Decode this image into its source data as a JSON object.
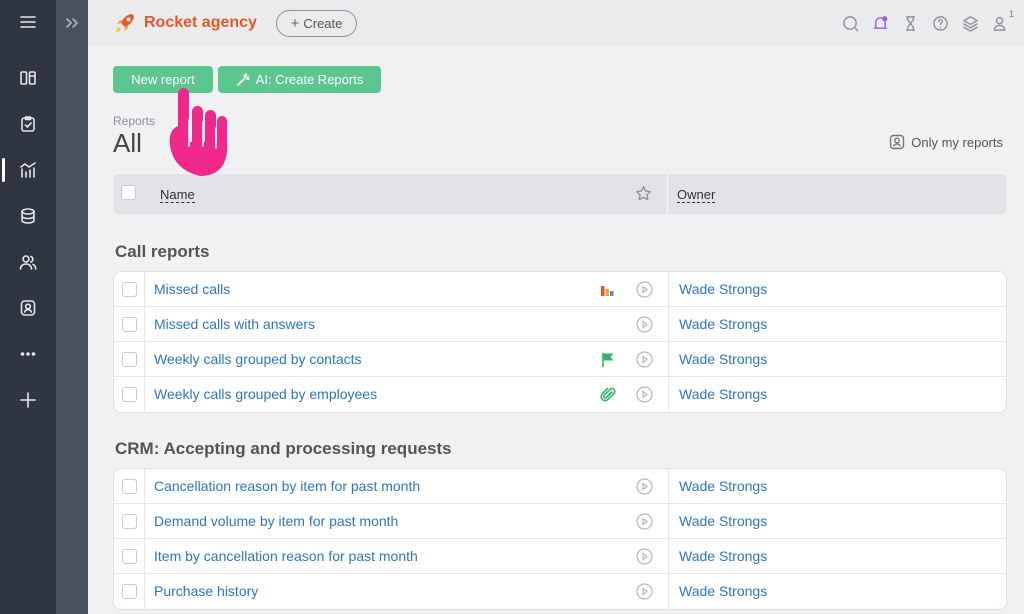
{
  "app": {
    "name": "Rocket agency",
    "brand_color": "#e8572a",
    "accent_color": "#5dc58f"
  },
  "topbar": {
    "create_label": "Create",
    "icons": [
      "search-icon",
      "bell-icon",
      "hourglass-icon",
      "help-icon",
      "layers-icon",
      "user-icon"
    ],
    "user_badge": "1"
  },
  "sidebar": {
    "items": [
      "dashboards-icon",
      "tasks-icon",
      "reports-icon",
      "database-icon",
      "contacts-icon",
      "profile-icon",
      "more-icon",
      "add-icon"
    ],
    "active": "reports-icon"
  },
  "actions": {
    "new_report": "New report",
    "ai_create": "AI: Create Reports"
  },
  "page": {
    "breadcrumb": "Reports",
    "title": "All",
    "only_my": "Only my reports"
  },
  "table": {
    "col_name": "Name",
    "col_owner": "Owner"
  },
  "sections": [
    {
      "title": "Call reports",
      "rows": [
        {
          "name": "Missed calls",
          "badge": "chart-icon",
          "owner": "Wade Strongs"
        },
        {
          "name": "Missed calls with answers",
          "badge": "",
          "owner": "Wade Strongs"
        },
        {
          "name": "Weekly calls grouped by contacts",
          "badge": "flag-icon",
          "owner": "Wade Strongs"
        },
        {
          "name": "Weekly calls grouped by employees",
          "badge": "paperclip-icon",
          "owner": "Wade Strongs"
        }
      ]
    },
    {
      "title": "CRM: Accepting and processing requests",
      "rows": [
        {
          "name": "Cancellation reason by item for past month",
          "badge": "",
          "owner": "Wade Strongs"
        },
        {
          "name": "Demand volume by item for past month",
          "badge": "",
          "owner": "Wade Strongs"
        },
        {
          "name": "Item by cancellation reason for past month",
          "badge": "",
          "owner": "Wade Strongs"
        },
        {
          "name": "Purchase history",
          "badge": "",
          "owner": "Wade Strongs"
        }
      ]
    }
  ]
}
